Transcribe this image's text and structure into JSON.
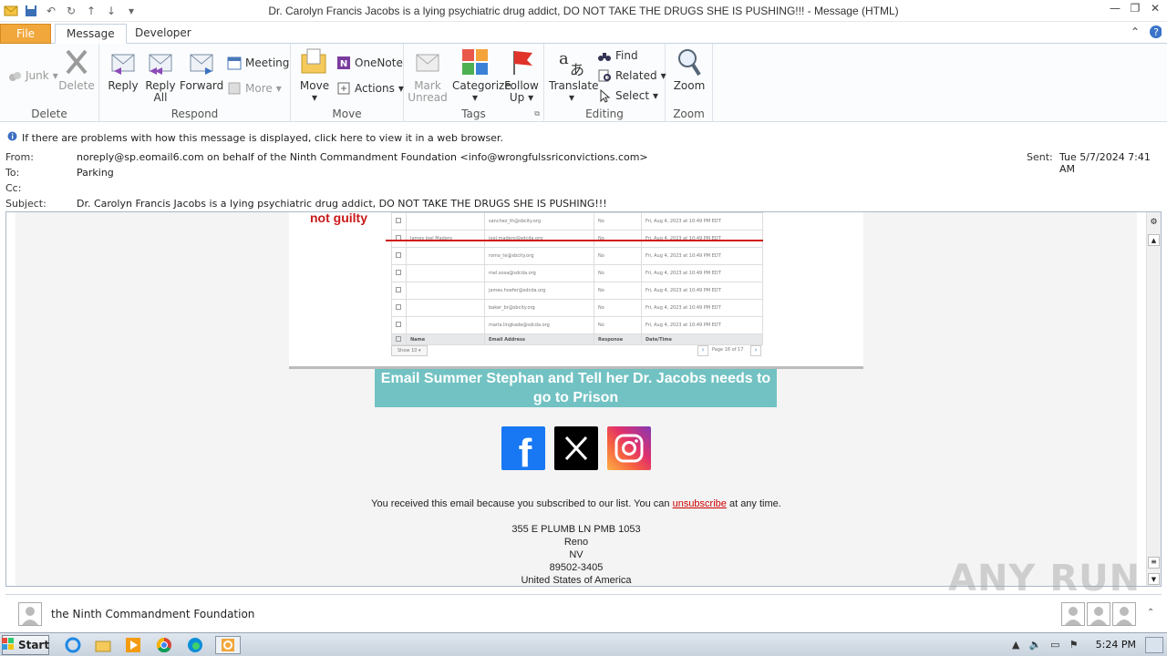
{
  "window": {
    "title": "Dr. Carolyn Francis Jacobs is a lying psychiatric drug addict, DO NOT TAKE THE DRUGS SHE IS PUSHING!!! - Message (HTML)"
  },
  "tabs": {
    "file": "File",
    "message": "Message",
    "developer": "Developer"
  },
  "ribbon": {
    "delete_group": {
      "label": "Delete",
      "junk": "Junk",
      "delete": "Delete"
    },
    "respond_group": {
      "label": "Respond",
      "reply": "Reply",
      "reply_all_1": "Reply",
      "reply_all_2": "All",
      "forward": "Forward",
      "meeting": "Meeting",
      "more": "More"
    },
    "move_group": {
      "label": "Move",
      "move": "Move",
      "onenote": "OneNote",
      "actions": "Actions"
    },
    "tags_group": {
      "label": "Tags",
      "mark_unread_1": "Mark",
      "mark_unread_2": "Unread",
      "categorize": "Categorize",
      "follow_up_1": "Follow",
      "follow_up_2": "Up"
    },
    "editing_group": {
      "label": "Editing",
      "translate": "Translate",
      "find": "Find",
      "related": "Related",
      "select": "Select"
    },
    "zoom_group": {
      "label": "Zoom",
      "zoom": "Zoom"
    }
  },
  "info": {
    "warning": "If there are problems with how this message is displayed, click here to view it in a web browser.",
    "from_label": "From:",
    "from_value": "noreply@sp.eomail6.com on behalf of the Ninth Commandment Foundation <info@wrongfulssriconvictions.com>",
    "to_label": "To:",
    "to_value": "Parking",
    "cc_label": "Cc:",
    "subject_label": "Subject:",
    "subject_value": "Dr. Carolyn Francis Jacobs is a lying psychiatric drug addict, DO NOT TAKE THE DRUGS SHE IS PUSHING!!!",
    "sent_label": "Sent:",
    "sent_value": "Tue 5/7/2024 7:41 AM"
  },
  "body": {
    "not_guilty": "not guilty",
    "table_rows": [
      {
        "name": "",
        "email": "sanchez_th@sbcity.org",
        "response": "No",
        "date": "Fri, Aug 4, 2023 at 10:49 PM EDT"
      },
      {
        "name": "James Joel Madero",
        "email": "joel.madero@sdcda.org",
        "response": "No",
        "date": "Fri, Aug 4, 2023 at 10:49 PM EDT"
      },
      {
        "name": "",
        "email": "romo_te@sbcity.org",
        "response": "No",
        "date": "Fri, Aug 4, 2023 at 10:49 PM EDT"
      },
      {
        "name": "",
        "email": "mel.sosa@sdcda.org",
        "response": "No",
        "date": "Fri, Aug 4, 2023 at 10:49 PM EDT"
      },
      {
        "name": "",
        "email": "james.hoefer@sdcda.org",
        "response": "No",
        "date": "Fri, Aug 4, 2023 at 10:49 PM EDT"
      },
      {
        "name": "",
        "email": "baker_br@sbcity.org",
        "response": "No",
        "date": "Fri, Aug 4, 2023 at 10:49 PM EDT"
      },
      {
        "name": "",
        "email": "marla.lingkade@sdcda.org",
        "response": "No",
        "date": "Fri, Aug 4, 2023 at 10:49 PM EDT"
      }
    ],
    "table_header": {
      "name": "Name",
      "email": "Email Address",
      "response": "Response",
      "date": "Date/Time"
    },
    "show_select": "Show 10",
    "page_text": "Page 16 of 17",
    "cta": "Email Summer Stephan and Tell her Dr. Jacobs needs to go to Prison",
    "subscribed_pre": "You received this email because you subscribed to our list. You can ",
    "unsubscribe": "unsubscribe",
    "subscribed_post": " at any time.",
    "address_1": "355 E PLUMB LN PMB 1053",
    "address_2": "Reno",
    "address_3": "NV",
    "address_4": "89502-3405",
    "address_5": "United States of America"
  },
  "people_pane": {
    "name": "the Ninth Commandment Foundation"
  },
  "taskbar": {
    "start": "Start",
    "clock": "5:24 PM"
  },
  "watermark": "ANY RUN",
  "colors": {
    "file_tab": "#f1a73b",
    "cta_bg": "#72c2c3",
    "accent_red": "#c91919",
    "facebook": "#1877f2"
  }
}
